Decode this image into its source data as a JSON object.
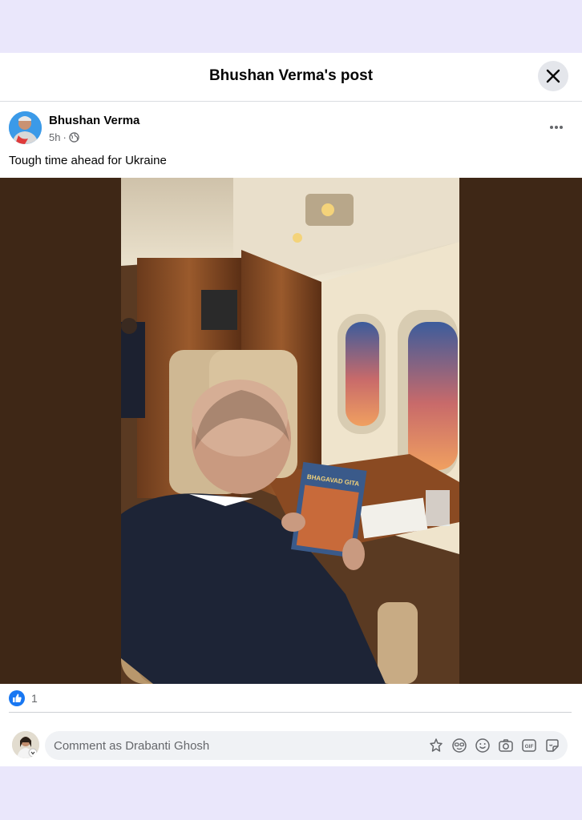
{
  "header": {
    "title": "Bhushan Verma's post"
  },
  "post": {
    "author": "Bhushan Verma",
    "time": "5h",
    "separator": "·",
    "text": "Tough time ahead for Ukraine",
    "book_title": "BHAGAVAD GITA"
  },
  "reactions": {
    "count": "1"
  },
  "comment": {
    "placeholder": "Comment as Drabanti Ghosh"
  },
  "colors": {
    "brand": "#1877f2",
    "media_bg": "#3e2716",
    "page_bg": "#eae7fb"
  },
  "icons": [
    "close-icon",
    "globe-icon",
    "more-options-icon",
    "like-icon",
    "avatar-sticker-icon",
    "sticker-icon",
    "emoji-icon",
    "camera-icon",
    "gif-icon",
    "sticker-note-icon"
  ]
}
